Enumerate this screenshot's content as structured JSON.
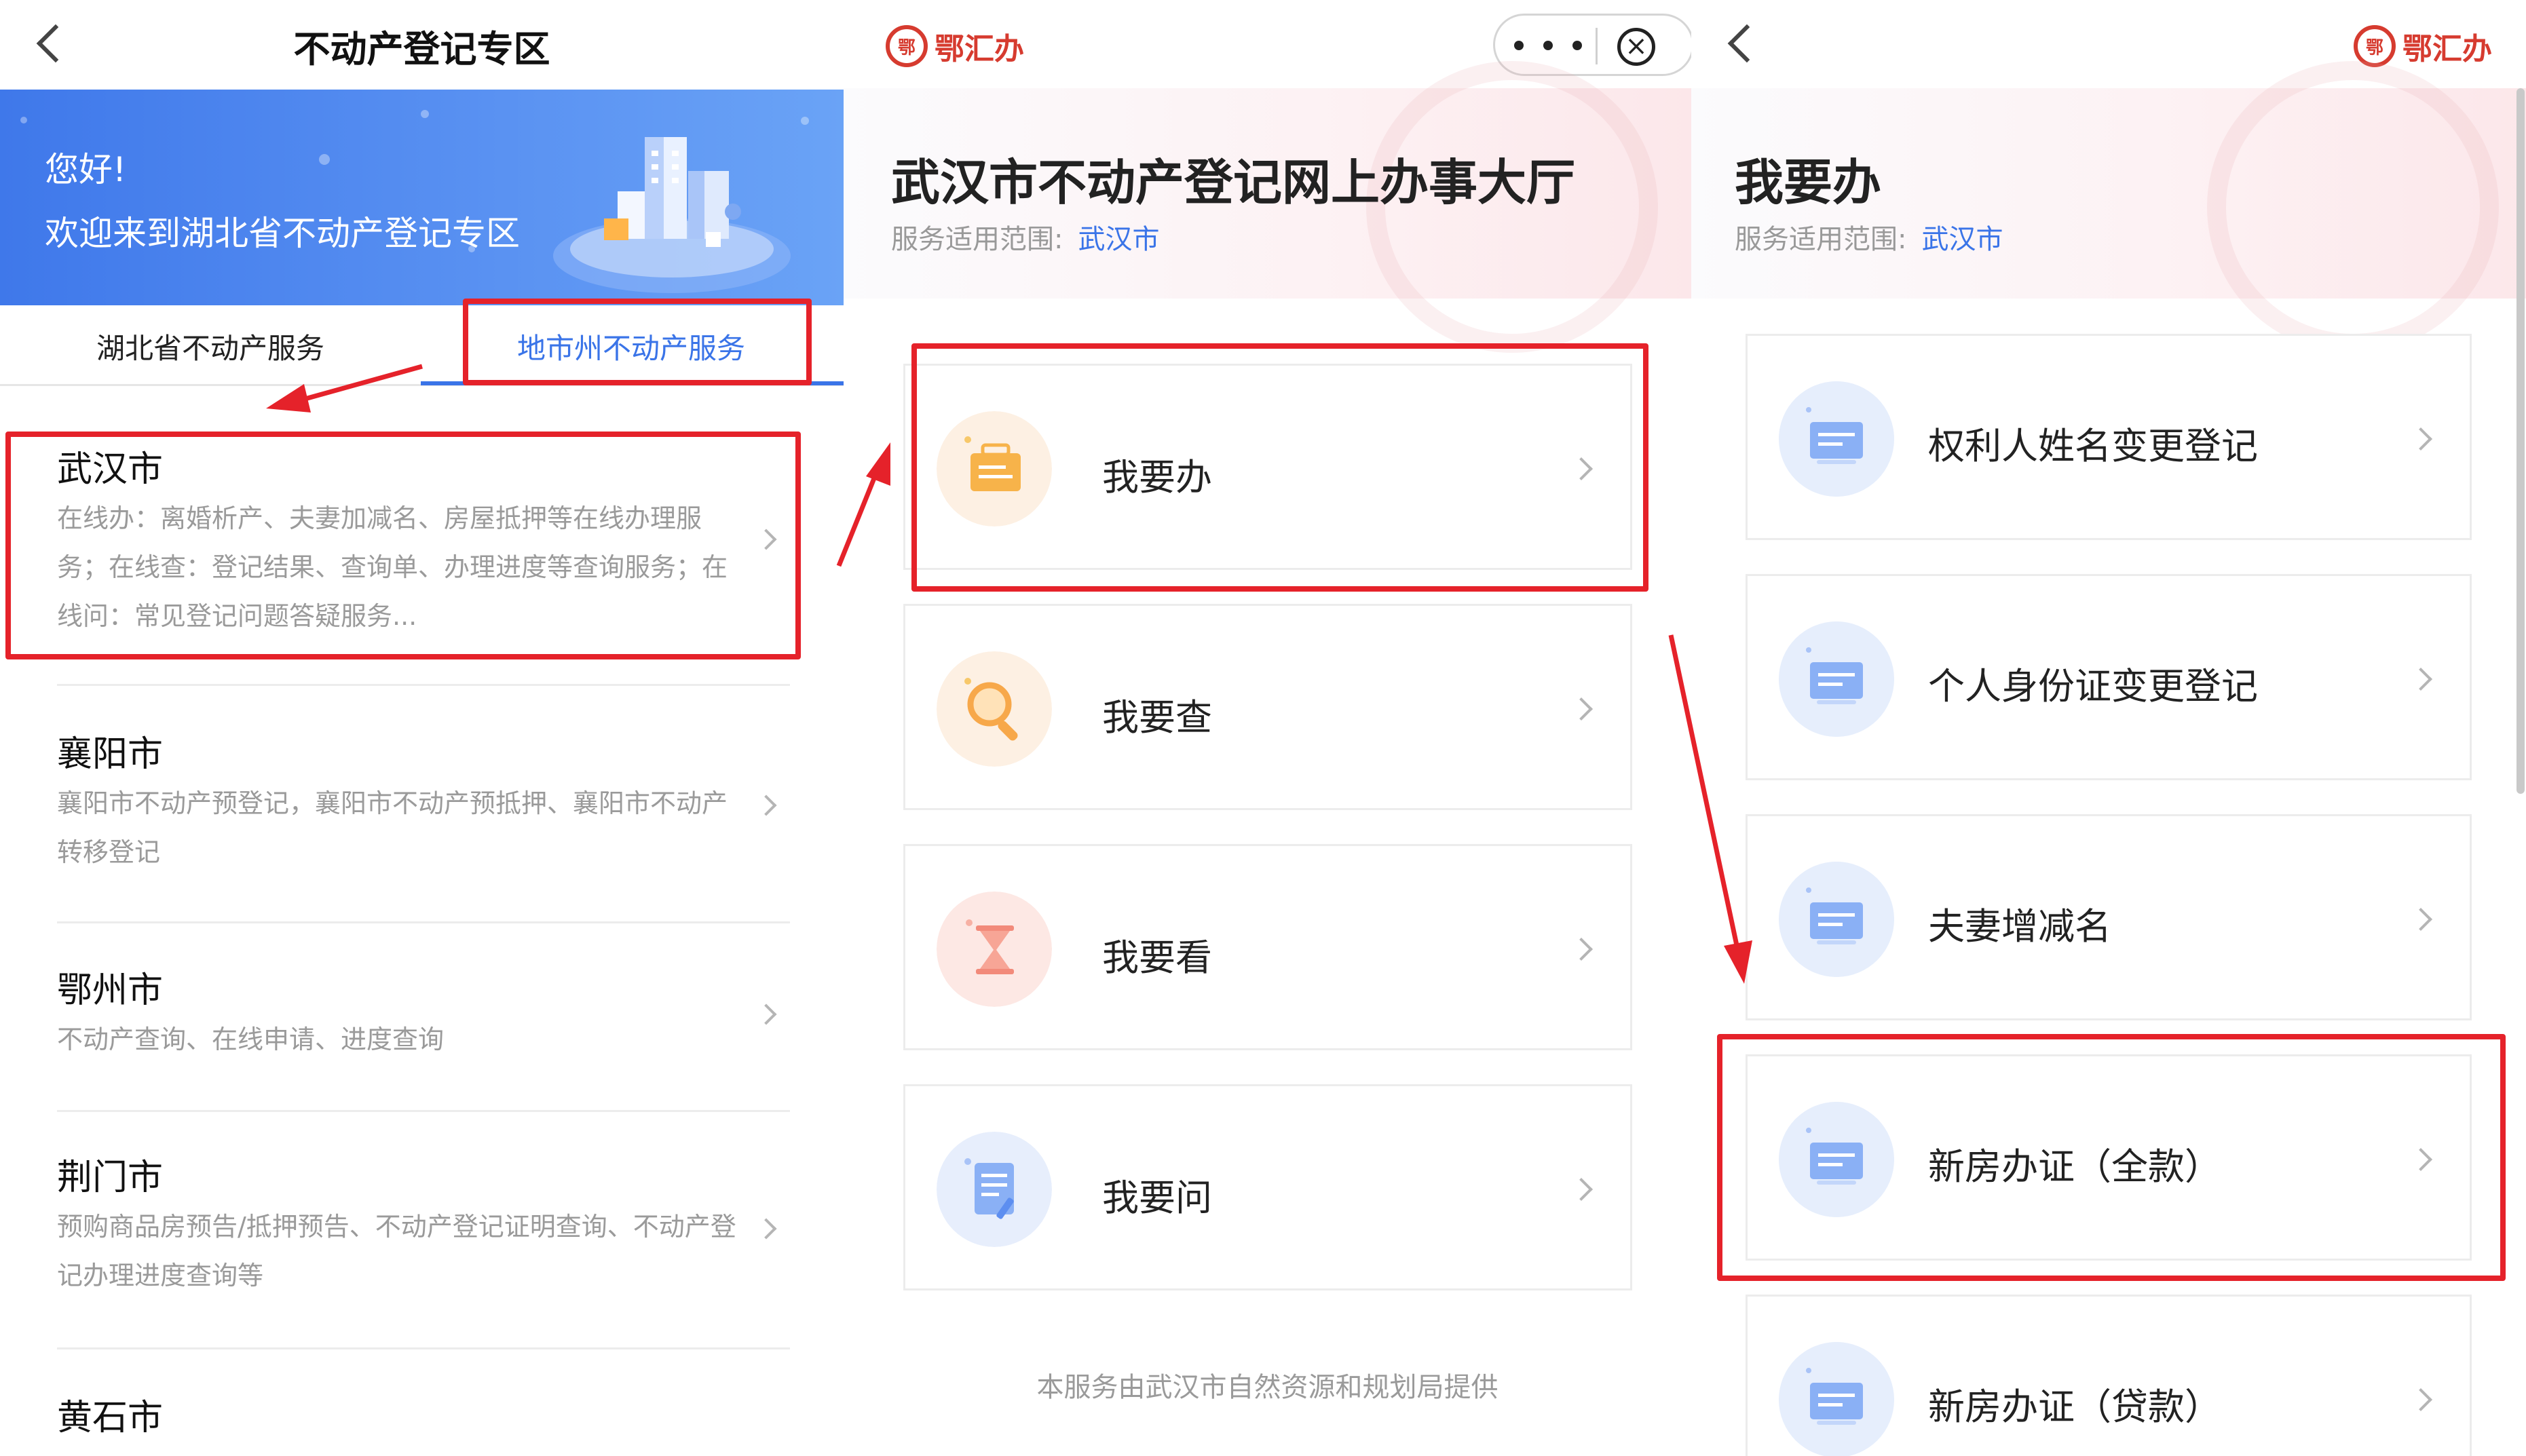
{
  "panel1": {
    "title": "不动产登记专区",
    "banner": {
      "greeting": "您好!",
      "welcome": "欢迎来到湖北省不动产登记专区"
    },
    "tabs": [
      {
        "label": "湖北省不动产服务",
        "active": false
      },
      {
        "label": "地市州不动产服务",
        "active": true
      }
    ],
    "cities": [
      {
        "name": "武汉市",
        "desc": "在线办：离婚析产、夫妻加减名、房屋抵押等在线办理服务；在线查：登记结果、查询单、办理进度等查询服务；在线问：常见登记问题答疑服务..."
      },
      {
        "name": "襄阳市",
        "desc": "襄阳市不动产预登记，襄阳市不动产预抵押、襄阳市不动产转移登记"
      },
      {
        "name": "鄂州市",
        "desc": "不动产查询、在线申请、进度查询"
      },
      {
        "name": "荆门市",
        "desc": "预购商品房预告/抵押预告、不动产登记证明查询、不动产登记办理进度查询等"
      },
      {
        "name": "黄石市",
        "desc": ""
      }
    ]
  },
  "panel2": {
    "brand": "鄂汇办",
    "brand_seal": "鄂",
    "capsule_close": "×",
    "title": "武汉市不动产登记网上办事大厅",
    "scope_label": "服务适用范围:",
    "scope_value": "武汉市",
    "services": [
      {
        "label": "我要办",
        "icon": "briefcase-icon"
      },
      {
        "label": "我要查",
        "icon": "magnifier-icon"
      },
      {
        "label": "我要看",
        "icon": "hourglass-icon"
      },
      {
        "label": "我要问",
        "icon": "document-edit-icon"
      }
    ],
    "footer": "本服务由武汉市自然资源和规划局提供"
  },
  "panel3": {
    "brand": "鄂汇办",
    "brand_seal": "鄂",
    "title": "我要办",
    "scope_label": "服务适用范围:",
    "scope_value": "武汉市",
    "items": [
      {
        "label": "权利人姓名变更登记"
      },
      {
        "label": "个人身份证变更登记"
      },
      {
        "label": "夫妻增减名"
      },
      {
        "label": "新房办证（全款）"
      },
      {
        "label": "新房办证（贷款）"
      }
    ]
  },
  "colors": {
    "accent_blue": "#3a74e8",
    "brand_red": "#d63b2f",
    "annotation_red": "#e5222a"
  }
}
